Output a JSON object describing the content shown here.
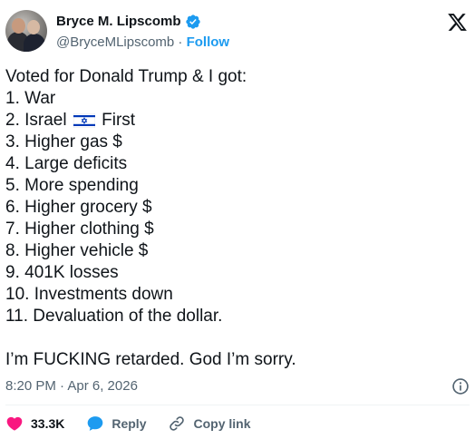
{
  "author": {
    "name": "Bryce M. Lipscomb",
    "handle": "@BryceMLipscomb",
    "separator": " · ",
    "follow_label": "Follow",
    "verified_color": "#1d9bf0"
  },
  "tweet": {
    "lines": [
      "Voted for Donald Trump & I got:",
      "1. War",
      "2. Israel",
      "First",
      "3. Higher gas $",
      "4. Large deficits",
      "5. More spending",
      "6. Higher grocery $",
      "7. Higher clothing $",
      "8. Higher vehicle $",
      "9. 401K losses",
      "10. Investments down",
      "11. Devaluation of the dollar.",
      "I’m FUCKING retarded. God I’m sorry."
    ],
    "timestamp": "8:20 PM · Apr 6, 2026"
  },
  "actions": {
    "like_count": "33.3K",
    "reply_label": "Reply",
    "copy_label": "Copy link",
    "like_color": "#f91880",
    "reply_color": "#1d9bf0"
  },
  "icons": [
    "verified-badge-icon",
    "x-logo-icon",
    "israel-flag-icon",
    "info-icon",
    "heart-icon",
    "reply-bubble-icon",
    "link-icon"
  ]
}
